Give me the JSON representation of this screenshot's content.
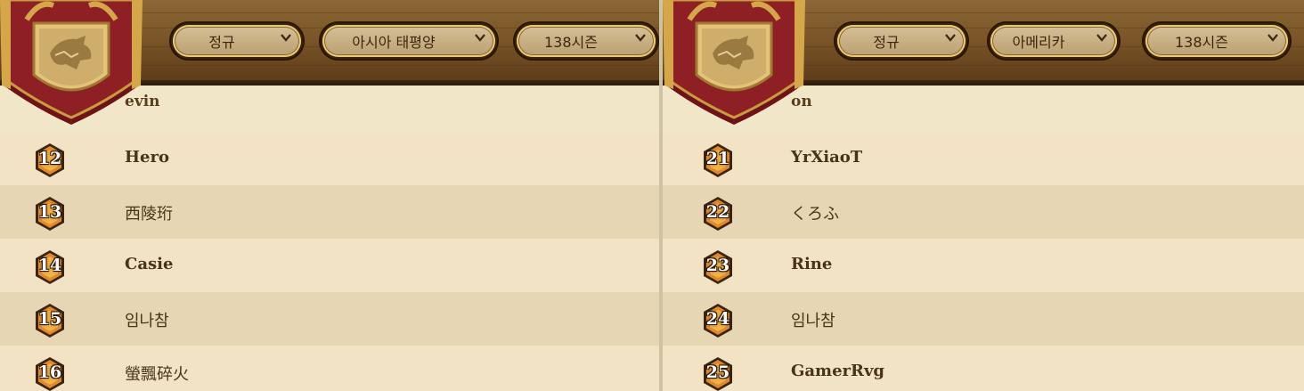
{
  "panels": [
    {
      "filters": {
        "mode": "정규",
        "region": "아시아 태평양",
        "season": "138시즌"
      },
      "header_fragment": "evin",
      "rows": [
        {
          "rank": "12",
          "name": "Hero",
          "bold": true
        },
        {
          "rank": "13",
          "name": "西陵珩",
          "bold": false
        },
        {
          "rank": "14",
          "name": "Casie",
          "bold": true
        },
        {
          "rank": "15",
          "name": "임나참",
          "bold": false
        },
        {
          "rank": "16",
          "name": "螢飄碎火",
          "bold": false
        }
      ]
    },
    {
      "filters": {
        "mode": "정규",
        "region": "아메리카",
        "season": "138시즌"
      },
      "header_fragment": "on",
      "rows": [
        {
          "rank": "21",
          "name": "YrXiaoT",
          "bold": true
        },
        {
          "rank": "22",
          "name": "くろふ",
          "bold": false
        },
        {
          "rank": "23",
          "name": "Rine",
          "bold": true
        },
        {
          "rank": "24",
          "name": "임나참",
          "bold": false
        },
        {
          "rank": "25",
          "name": "GamerRvg",
          "bold": true
        }
      ]
    }
  ],
  "icons": {
    "crest": "dragon-crest-icon",
    "chevron": "chevron-down-icon",
    "rank": "rank-badge-icon"
  },
  "colors": {
    "wood": "#7a5527",
    "banner": "#8a1f22",
    "gold": "#e0b04a",
    "row_light": "#f1e3c4",
    "row_dark": "#e6d6b3"
  }
}
